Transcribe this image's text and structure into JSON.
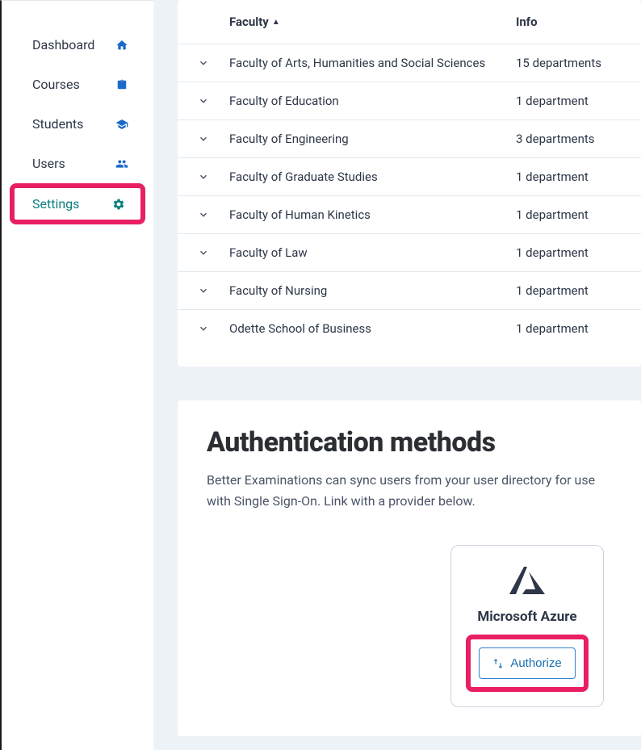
{
  "sidebar": {
    "items": [
      {
        "label": "Dashboard",
        "icon": "home"
      },
      {
        "label": "Courses",
        "icon": "clipboard"
      },
      {
        "label": "Students",
        "icon": "student"
      },
      {
        "label": "Users",
        "icon": "users"
      },
      {
        "label": "Settings",
        "icon": "gear",
        "active": true
      }
    ]
  },
  "faculty_table": {
    "headers": {
      "faculty": "Faculty",
      "info": "Info"
    },
    "rows": [
      {
        "name": "Faculty of Arts, Humanities and Social Sciences",
        "info": "15 departments"
      },
      {
        "name": "Faculty of Education",
        "info": "1 department"
      },
      {
        "name": "Faculty of Engineering",
        "info": "3 departments"
      },
      {
        "name": "Faculty of Graduate Studies",
        "info": "1 department"
      },
      {
        "name": "Faculty of Human Kinetics",
        "info": "1 department"
      },
      {
        "name": "Faculty of Law",
        "info": "1 department"
      },
      {
        "name": "Faculty of Nursing",
        "info": "1 department"
      },
      {
        "name": "Odette School of Business",
        "info": "1 department"
      }
    ]
  },
  "auth": {
    "title": "Authentication methods",
    "description": "Better Examinations can sync users from your user directory for use with Single Sign-On. Link with a provider below.",
    "provider": {
      "name": "Microsoft Azure",
      "button": "Authorize"
    }
  }
}
